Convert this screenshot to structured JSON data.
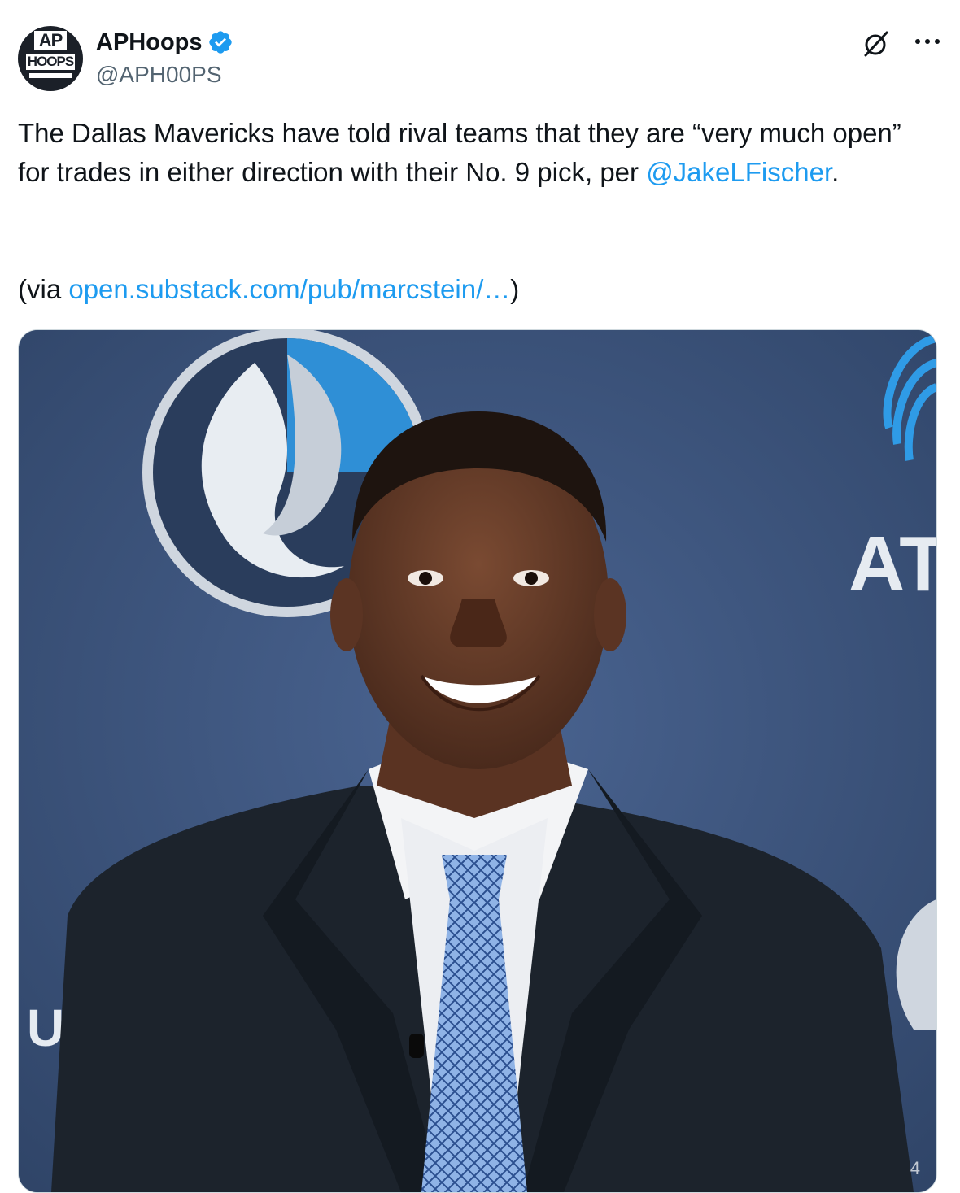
{
  "account": {
    "display_name": "APHoops",
    "handle": "@APH00PS",
    "avatar_text_top": "AP",
    "avatar_text_bottom": "HOOPS"
  },
  "tweet": {
    "text_part1": "The Dallas Mavericks have told rival teams that they are “very much open” for trades in either direction with their No. 9 pick, per ",
    "mention": "@JakeLFischer",
    "text_part2": ".",
    "via_prefix": "(via ",
    "via_link": "open.substack.com/pub/marcstein/…",
    "via_suffix": ")"
  },
  "media": {
    "backdrop_text_right": "AT",
    "backdrop_text_left": "U",
    "corner_mark": "4"
  },
  "icons": {
    "verified": "verified-badge-icon",
    "grok": "grok-icon",
    "more": "more-options-icon"
  },
  "colors": {
    "link": "#1d9bf0",
    "text": "#0f1419",
    "secondary": "#536471",
    "backdrop": "#3c5378"
  }
}
